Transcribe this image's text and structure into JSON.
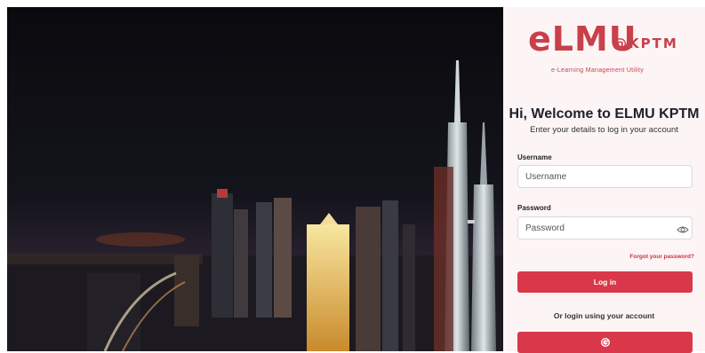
{
  "brand": {
    "logo_text": "eLMU",
    "logo_suffix": "@KPTM",
    "tagline": "e-Learning Management Utility"
  },
  "welcome": {
    "title": "Hi, Welcome to ELMU KPTM",
    "subtitle": "Enter your details to log in your account"
  },
  "form": {
    "username_label": "Username",
    "username_placeholder": "Username",
    "password_label": "Password",
    "password_placeholder": "Password",
    "forgot_label": "Forgot your password?",
    "login_label": "Log in",
    "alt_login_text": "Or login using your account"
  },
  "icons": {
    "password_toggle": "eye-icon",
    "social_login": "google-icon"
  },
  "colors": {
    "accent": "#d9384a",
    "brand": "#c8404a",
    "panel_bg": "#fdf5f5"
  }
}
